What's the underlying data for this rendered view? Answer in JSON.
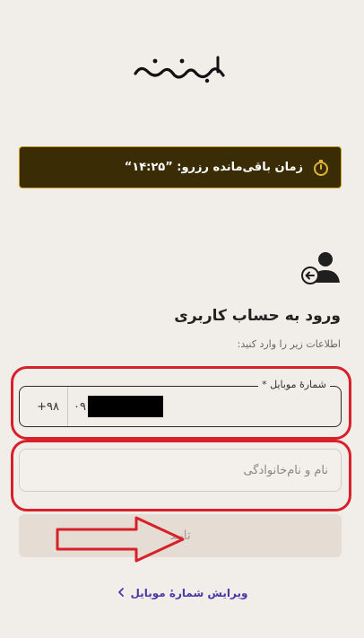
{
  "logo": {
    "text": "فیدیبو"
  },
  "timer": {
    "label": "زمان باقی‌مانده رزرو: ”۱۴:۲۵“",
    "icon": "stopwatch-icon"
  },
  "login": {
    "icon": "user-login-icon",
    "title": "ورود به حساب کاربری",
    "subtitle": "اطلاعات زیر را وارد کنید:"
  },
  "phone_field": {
    "label": "شمارهٔ موبایل *",
    "prefix": "+۹۸",
    "value": "۰۹"
  },
  "name_field": {
    "placeholder": "نام و نام‌خانوادگی"
  },
  "submit": {
    "label": "تایید"
  },
  "edit_link": {
    "label": "ویرایش شمارهٔ موبایل",
    "icon": "chevron-left-icon"
  },
  "colors": {
    "background": "#f1ede8",
    "timer_bg": "#3a2d05",
    "accent": "#c9a227",
    "highlight": "#d8202a",
    "link": "#4a3aa8"
  }
}
